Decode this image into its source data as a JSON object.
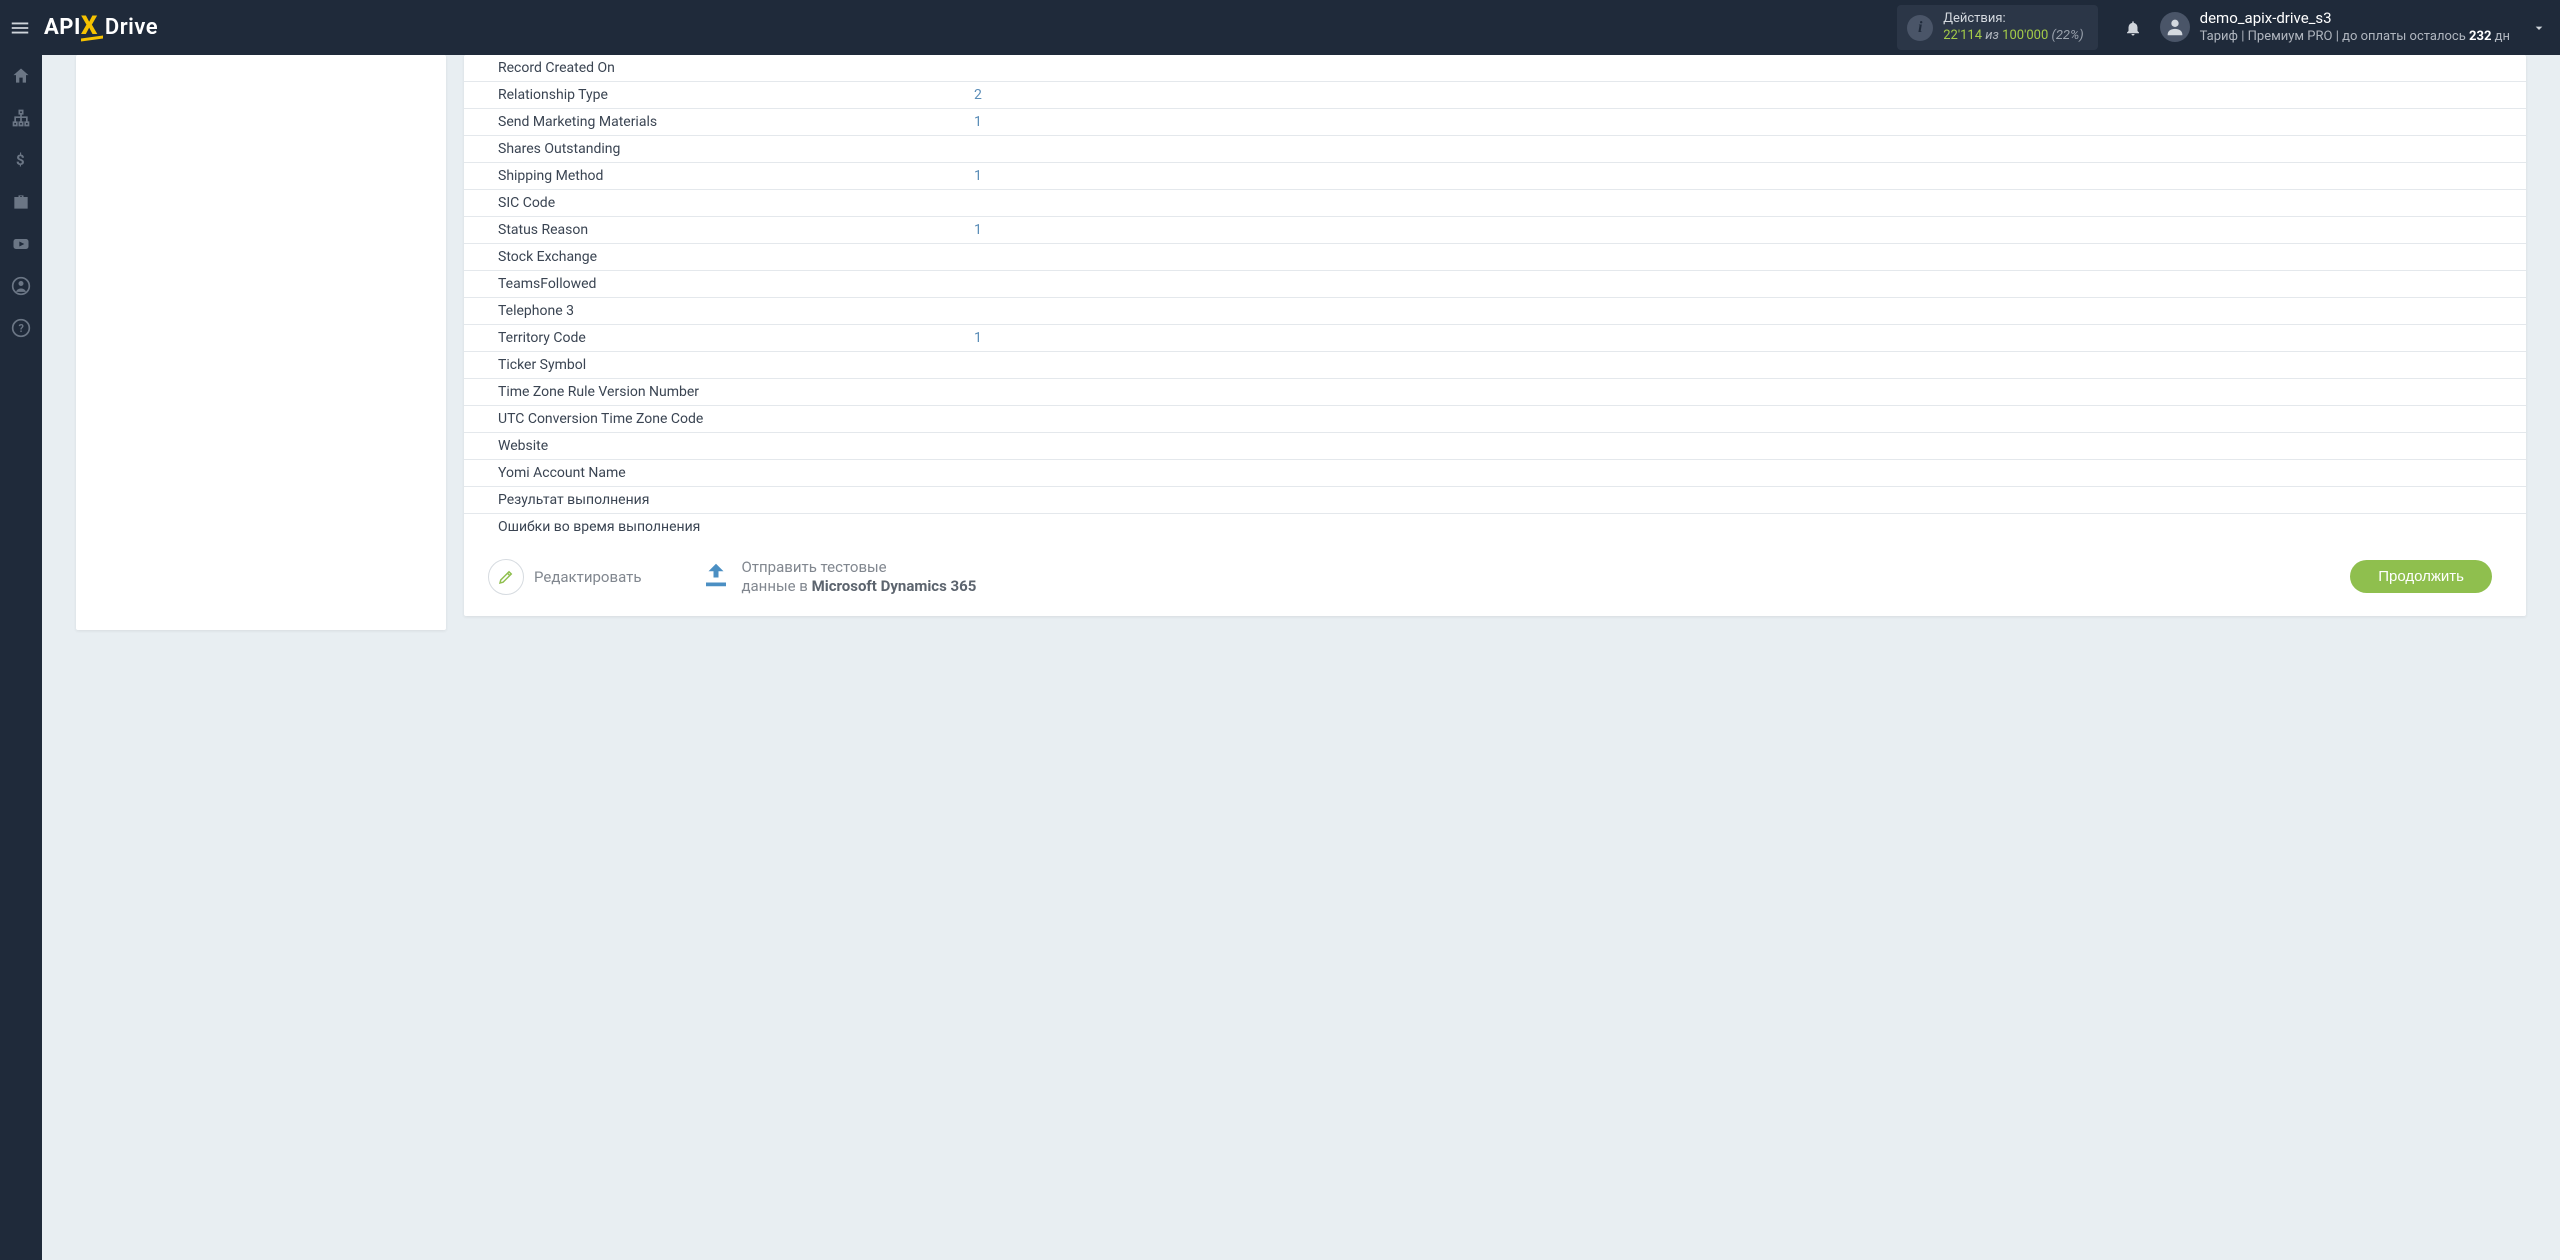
{
  "logo": {
    "left": "API",
    "mid": "X",
    "right": "Drive"
  },
  "header": {
    "actions_label": "Действия:",
    "actions_count": "22'114",
    "actions_iz": "из",
    "actions_total": "100'000",
    "actions_pct": "(22%)"
  },
  "user": {
    "name": "demo_apix-drive_s3",
    "tariff_label": "Тариф",
    "tariff_value": "Премиум PRO",
    "payment_prefix": "до оплаты осталось",
    "payment_days": "232",
    "payment_unit": "дн"
  },
  "fields": [
    {
      "label": "Record Created On",
      "value": ""
    },
    {
      "label": "Relationship Type",
      "value": "2"
    },
    {
      "label": "Send Marketing Materials",
      "value": "1"
    },
    {
      "label": "Shares Outstanding",
      "value": ""
    },
    {
      "label": "Shipping Method",
      "value": "1"
    },
    {
      "label": "SIC Code",
      "value": ""
    },
    {
      "label": "Status Reason",
      "value": "1"
    },
    {
      "label": "Stock Exchange",
      "value": ""
    },
    {
      "label": "TeamsFollowed",
      "value": ""
    },
    {
      "label": "Telephone 3",
      "value": ""
    },
    {
      "label": "Territory Code",
      "value": "1"
    },
    {
      "label": "Ticker Symbol",
      "value": ""
    },
    {
      "label": "Time Zone Rule Version Number",
      "value": ""
    },
    {
      "label": "UTC Conversion Time Zone Code",
      "value": ""
    },
    {
      "label": "Website",
      "value": ""
    },
    {
      "label": "Yomi Account Name",
      "value": ""
    },
    {
      "label": "Результат выполнения",
      "value": ""
    },
    {
      "label": "Ошибки во время выполнения",
      "value": ""
    }
  ],
  "buttons": {
    "edit": "Редактировать",
    "send_line1": "Отправить тестовые",
    "send_line2_prefix": "данные в ",
    "send_line2_bold": "Microsoft Dynamics 365",
    "continue": "Продолжить"
  }
}
